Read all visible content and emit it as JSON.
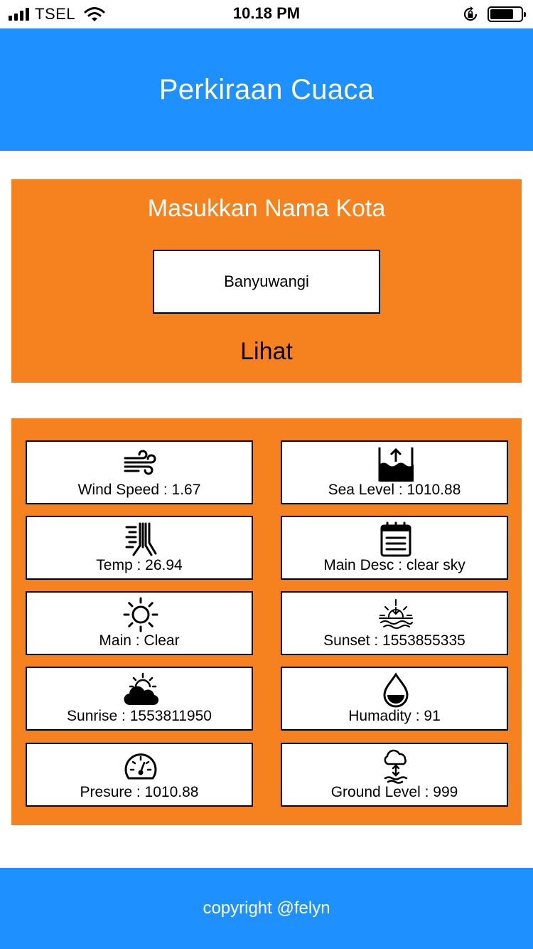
{
  "status_bar": {
    "carrier": "TSEL",
    "time": "10.18 PM",
    "battery_level": 0.75
  },
  "header": {
    "title": "Perkiraan Cuaca"
  },
  "search": {
    "label": "Masukkan Nama Kota",
    "city_value": "Banyuwangi",
    "button_label": "Lihat"
  },
  "info": {
    "wind_speed": "Wind Speed : 1.67",
    "sea_level": "Sea Level : 1010.88",
    "temp": "Temp : 26.94",
    "main_desc": "Main Desc : clear sky",
    "main": "Main : Clear",
    "sunset": "Sunset : 1553855335",
    "sunrise": "Sunrise : 1553811950",
    "humidity": "Humadity : 91",
    "pressure": "Presure : 1010.88",
    "ground_level": "Ground Level : 999"
  },
  "footer": {
    "copyright": "copyright @felyn"
  },
  "colors": {
    "header_blue": "#1e90ff",
    "panel_orange": "#f5821f"
  }
}
